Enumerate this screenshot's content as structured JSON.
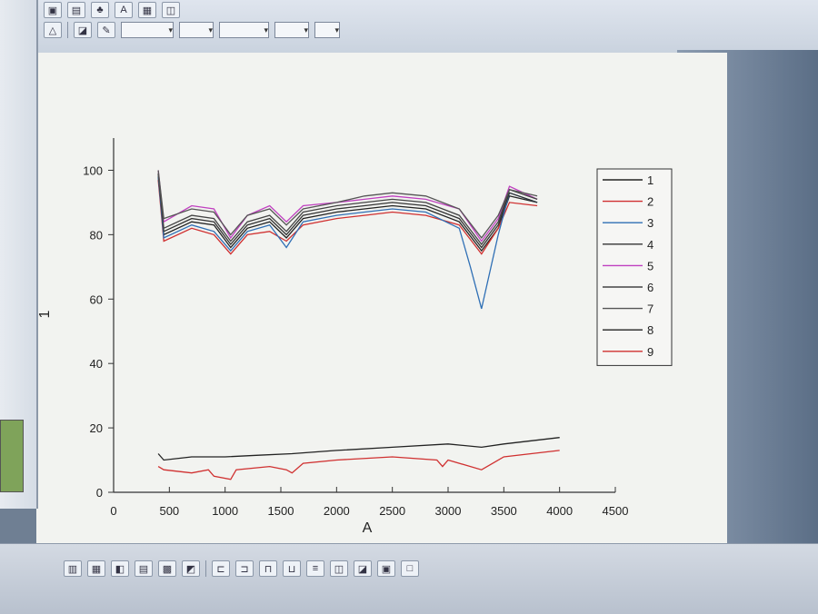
{
  "chart_data": {
    "type": "line",
    "xlabel": "A",
    "ylabel": "1",
    "xlim": [
      0,
      4500
    ],
    "ylim": [
      0,
      110
    ],
    "xticks": [
      0,
      500,
      1000,
      1500,
      2000,
      2500,
      3000,
      3500,
      4000,
      4500
    ],
    "yticks": [
      0,
      20,
      40,
      60,
      80,
      100
    ],
    "legend_position": "right",
    "series": [
      {
        "name": "1",
        "color": "#222222",
        "x": [
          400,
          450,
          700,
          900,
          1050,
          1200,
          1400,
          1550,
          1700,
          2000,
          2250,
          2500,
          2800,
          3100,
          3300,
          3450,
          3550,
          3800
        ],
        "y": [
          98,
          80,
          84,
          83,
          76,
          82,
          84,
          79,
          85,
          87,
          88,
          89,
          88,
          84,
          75,
          82,
          92,
          90
        ]
      },
      {
        "name": "2",
        "color": "#d03030",
        "x": [
          400,
          450,
          700,
          900,
          1050,
          1200,
          1400,
          1550,
          1700,
          2000,
          2250,
          2500,
          2800,
          3100,
          3300,
          3450,
          3550,
          3800
        ],
        "y": [
          97,
          78,
          82,
          80,
          74,
          80,
          81,
          78,
          83,
          85,
          86,
          87,
          86,
          83,
          74,
          82,
          90,
          89
        ]
      },
      {
        "name": "3",
        "color": "#2f6fb5",
        "x": [
          400,
          450,
          700,
          900,
          1050,
          1200,
          1400,
          1550,
          1700,
          2000,
          2250,
          2500,
          2800,
          3100,
          3200,
          3300,
          3450,
          3550,
          3800
        ],
        "y": [
          98,
          79,
          83,
          81,
          75,
          81,
          83,
          76,
          84,
          86,
          87,
          88,
          87,
          82,
          70,
          57,
          80,
          93,
          90
        ]
      },
      {
        "name": "4",
        "color": "#333333",
        "x": [
          400,
          450,
          700,
          900,
          1050,
          1200,
          1400,
          1550,
          1700,
          2000,
          2250,
          2500,
          2800,
          3100,
          3300,
          3450,
          3550,
          3800
        ],
        "y": [
          99,
          81,
          85,
          84,
          77,
          83,
          85,
          80,
          86,
          88,
          89,
          90,
          89,
          85,
          76,
          83,
          93,
          90
        ]
      },
      {
        "name": "5",
        "color": "#c040c0",
        "x": [
          400,
          450,
          700,
          900,
          1050,
          1200,
          1400,
          1550,
          1700,
          2000,
          2250,
          2500,
          2800,
          3100,
          3300,
          3450,
          3550,
          3800
        ],
        "y": [
          100,
          84,
          89,
          88,
          79,
          86,
          89,
          84,
          89,
          90,
          91,
          92,
          91,
          88,
          78,
          85,
          95,
          91
        ]
      },
      {
        "name": "6",
        "color": "#444444",
        "x": [
          400,
          450,
          700,
          900,
          1050,
          1200,
          1400,
          1550,
          1700,
          2000,
          2250,
          2500,
          2800,
          3100,
          3300,
          3450,
          3550,
          3800
        ],
        "y": [
          99,
          82,
          86,
          85,
          78,
          84,
          86,
          81,
          87,
          89,
          90,
          91,
          90,
          86,
          77,
          84,
          94,
          91
        ]
      },
      {
        "name": "7",
        "color": "#555555",
        "x": [
          400,
          450,
          700,
          900,
          1050,
          1200,
          1400,
          1550,
          1700,
          2000,
          2250,
          2500,
          2800,
          3100,
          3300,
          3450,
          3550,
          3800
        ],
        "y": [
          100,
          85,
          88,
          87,
          80,
          86,
          88,
          83,
          88,
          90,
          92,
          93,
          92,
          88,
          79,
          86,
          94,
          92
        ]
      },
      {
        "name": "8",
        "color": "#222222",
        "x": [
          400,
          450,
          700,
          1000,
          1300,
          1600,
          2000,
          2500,
          3000,
          3300,
          3500,
          4000
        ],
        "y": [
          12,
          10,
          11,
          11,
          11.5,
          12,
          13,
          14,
          15,
          14,
          15,
          17
        ]
      },
      {
        "name": "9",
        "color": "#d03030",
        "x": [
          400,
          450,
          700,
          850,
          900,
          1050,
          1100,
          1400,
          1550,
          1600,
          1700,
          2000,
          2500,
          2900,
          2950,
          3000,
          3300,
          3500,
          4000
        ],
        "y": [
          8,
          7,
          6,
          7,
          5,
          4,
          7,
          8,
          7,
          6,
          9,
          10,
          11,
          10,
          8,
          10,
          7,
          11,
          13
        ]
      }
    ]
  }
}
